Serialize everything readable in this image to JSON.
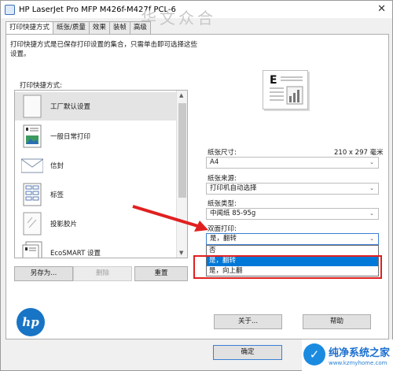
{
  "window": {
    "title": "HP LaserJet Pro MFP M426f-M427f PCL-6",
    "close_glyph": "✕"
  },
  "tabs": [
    "打印快捷方式",
    "纸张/质量",
    "效果",
    "装帧",
    "高级"
  ],
  "description": "打印快捷方式是已保存打印设置的集合，只需单击即可选择这些设置。",
  "shortcuts": {
    "label": "打印快捷方式:",
    "items": [
      {
        "label": "工厂默认设置",
        "icon": "blank-page-icon"
      },
      {
        "label": "一般日常打印",
        "icon": "document-image-icon"
      },
      {
        "label": "信封",
        "icon": "envelope-icon"
      },
      {
        "label": "标签",
        "icon": "labels-sheet-icon"
      },
      {
        "label": "投影胶片",
        "icon": "transparency-icon"
      },
      {
        "label": "EcoSMART 设置",
        "icon": "eco-document-icon"
      }
    ]
  },
  "buttons": {
    "save_as": "另存为...",
    "delete": "删除",
    "reset": "重置",
    "about": "关于...",
    "help": "帮助",
    "ok": "确定"
  },
  "paper_size": {
    "label": "纸张尺寸:",
    "dimensions": "210 x 297 毫米",
    "value": "A4"
  },
  "paper_source": {
    "label": "纸张来源:",
    "value": "打印机自动选择"
  },
  "paper_type": {
    "label": "纸张类型:",
    "value": "中闻纸 85-95g"
  },
  "duplex": {
    "label": "双面打印:",
    "value": "是，翻转",
    "options": [
      "否",
      "是，翻转",
      "是，向上翻"
    ],
    "highlighted_index": 1
  },
  "logo": {
    "text": "hp"
  },
  "watermarks": {
    "top": "华文众合",
    "bottom_title": "纯净系统之家",
    "bottom_url": "www.kzmyhome.com"
  },
  "colors": {
    "accent": "#0078d7",
    "annotation_red": "#e02020",
    "hp_blue": "#1874c5"
  }
}
